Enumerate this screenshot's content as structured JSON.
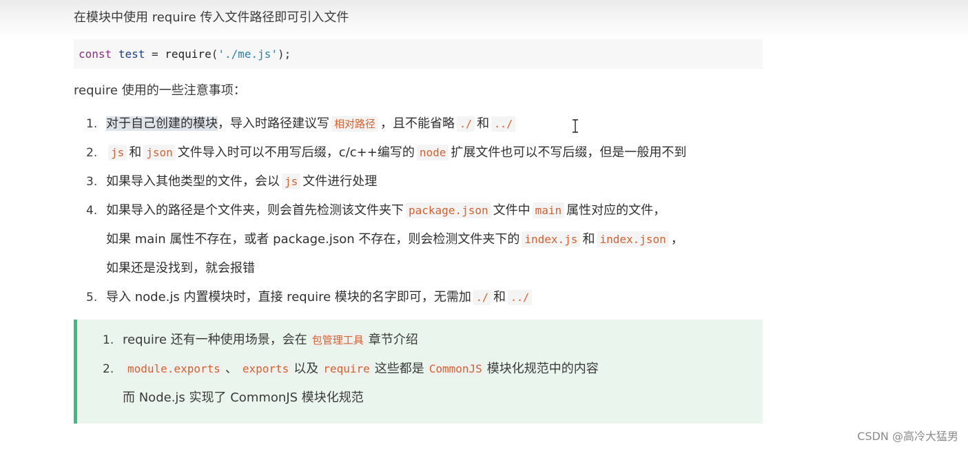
{
  "intro": "在模块中使用 require 传入文件路径即可引入文件",
  "code": {
    "keyword": "const",
    "variable": "test",
    "equals": "=",
    "function": "require",
    "open": "(",
    "string": "'./me.js'",
    "close": ");"
  },
  "notes_title": "require 使用的一些注意事项：",
  "items": [
    {
      "num": "1.",
      "highlight": "对于自己创建的模块",
      "t1": "，导入时路径建议写",
      "c1": "相对路径",
      "t2": "，且不能省略",
      "c2": "./",
      "t3": "和",
      "c3": "../"
    },
    {
      "num": "2.",
      "c1": "js",
      "t1": "和",
      "c2": "json",
      "t2": "文件导入时可以不用写后缀，c/c++编写的",
      "c3": "node",
      "t3": "扩展文件也可以不写后缀，但是一般用不到"
    },
    {
      "num": "3.",
      "t1": "如果导入其他类型的文件，会以",
      "c1": "js",
      "t2": "文件进行处理"
    },
    {
      "num": "4.",
      "t1": "如果导入的路径是个文件夹，则会首先检测该文件夹下",
      "c1": "package.json",
      "t2": "文件中",
      "c2": "main",
      "t3": "属性对应的文件，",
      "line2_t1": "如果 main 属性不存在，或者 package.json 不存在，则会检测文件夹下的",
      "line2_c1": "index.js",
      "line2_t2": "和",
      "line2_c2": "index.json",
      "line2_t3": "，",
      "line3": "如果还是没找到，就会报错"
    },
    {
      "num": "5.",
      "t1": "导入 node.js 内置模块时，直接 require 模块的名字即可，无需加",
      "c1": "./",
      "t2": "和",
      "c2": "../"
    }
  ],
  "tip": {
    "items": [
      {
        "num": "1.",
        "t1": "require 还有一种使用场景，会在",
        "c1": "包管理工具",
        "t2": "章节介绍"
      },
      {
        "num": "2.",
        "c1": "module.exports",
        "t1": "、",
        "c2": "exports",
        "t2": "以及",
        "c3": "require",
        "t3": "这些都是",
        "c4": "CommonJS",
        "t4": "模块化规范中的内容",
        "line2": "而 Node.js 实现了 CommonJS 模块化规范"
      }
    ],
    "accent": "#42b983",
    "background": "#eaf5ee"
  },
  "watermark": "CSDN @高冷大猛男",
  "colors": {
    "inline_code": "#d4602f",
    "keyword": "#8a2f7a",
    "string": "#2d7fa3"
  }
}
